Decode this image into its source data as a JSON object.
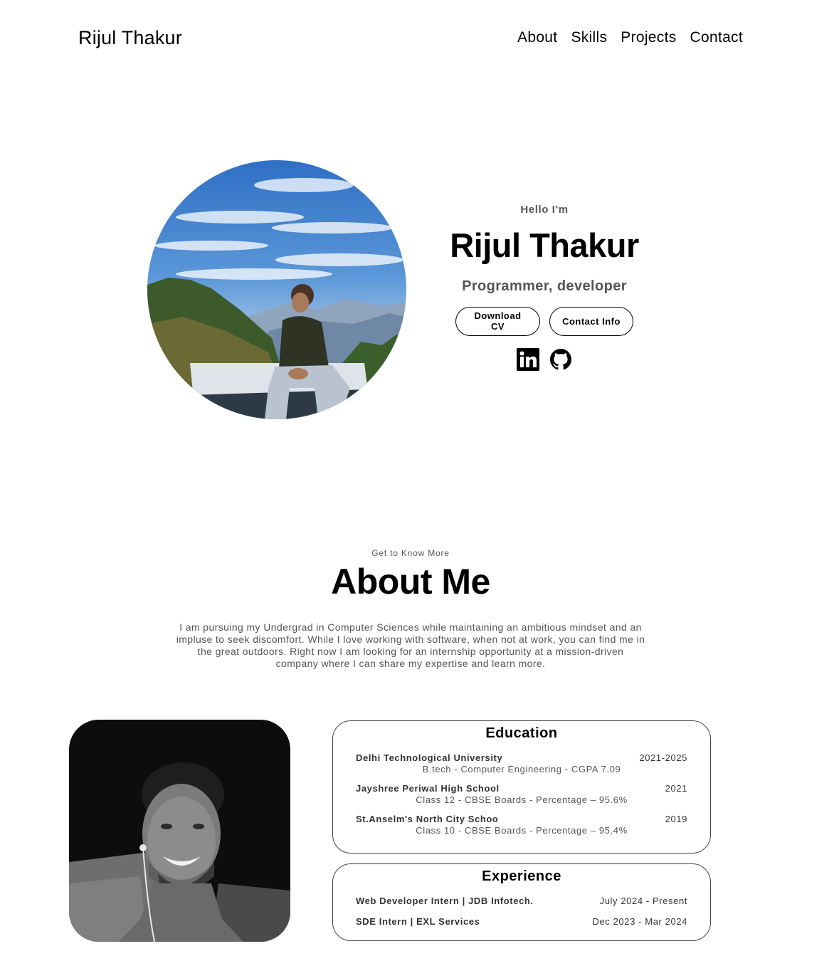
{
  "nav": {
    "logo": "Rijul Thakur",
    "links": [
      "About",
      "Skills",
      "Projects",
      "Contact"
    ]
  },
  "hero": {
    "greeting": "Hello I'm",
    "name": "Rijul Thakur",
    "title": "Programmer, developer",
    "buttons": {
      "cv": "Download CV",
      "contact": "Contact Info"
    },
    "socials": [
      "linkedin-icon",
      "github-icon"
    ]
  },
  "about": {
    "subtitle": "Get to Know More",
    "title": "About Me",
    "paragraph": "I am pursuing my Undergrad in Computer Sciences while maintaining an ambitious mindset and an impluse to seek discomfort. While I love working with software, when not at work, you can find me in the great outdoors. Right now I am looking for an internship opportunity at a mission-driven company where I can share my expertise and learn more."
  },
  "education": {
    "title": "Education",
    "items": [
      {
        "school": "Delhi Technological University",
        "years": "2021-2025",
        "detail": "B.tech - Computer Engineering - CGPA 7.09"
      },
      {
        "school": "Jayshree Periwal High School",
        "years": "2021",
        "detail": "Class 12 - CBSE Boards - Percentage – 95.6%"
      },
      {
        "school": "St.Anselm's North City Schoo",
        "years": "2019",
        "detail": "Class 10 - CBSE Boards - Percentage – 95.4%"
      }
    ]
  },
  "experience": {
    "title": "Experience",
    "items": [
      {
        "role": "Web Developer Intern | JDB Infotech.",
        "period": "July 2024 - Present"
      },
      {
        "role": "SDE Intern | EXL Services",
        "period": "Dec 2023 - Mar 2024"
      }
    ]
  }
}
